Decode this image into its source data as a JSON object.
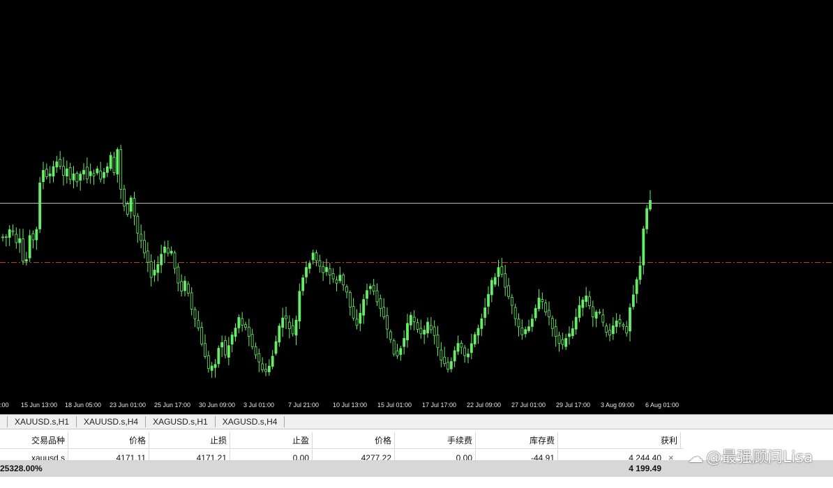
{
  "time_axis": {
    "labels": [
      ":00",
      "15 Jun 13:00",
      "18 Jun 05:00",
      "23 Jun 01:00",
      "25 Jun 17:00",
      "30 Jun 09:00",
      "3 Jul 01:00",
      "7 Jul 21:00",
      "10 Jul 13:00",
      "15 Jul 01:00",
      "17 Jul 17:00",
      "22 Jul 09:00",
      "27 Jul 01:00",
      "29 Jul 17:00",
      "3 Aug 09:00",
      "6 Aug 01:00"
    ]
  },
  "tabs": [
    "XAUUSD.s,H1",
    "XAUUSD.s,H4",
    "XAGUSD.s,H1",
    "XAGUSD.s,H4"
  ],
  "terminal": {
    "headers": [
      "交易品种",
      "价格",
      "止损",
      "止盈",
      "价格",
      "手续费",
      "库存费",
      "获利"
    ],
    "row": [
      "xauusd.s",
      "4171.11",
      "4171.21",
      "0.00",
      "4277.22",
      "0.00",
      "-44.91",
      "4 244.40"
    ],
    "close_symbol": "×",
    "summary_left": "25328.00%",
    "summary_profit": "4 199.49"
  },
  "watermark": {
    "logo": "☁",
    "text": "@最强顾问Lisa"
  },
  "colors": {
    "background": "#000000",
    "candle": "#66ee66",
    "hline": "#b8b8b8",
    "dashline": "#c83a1e"
  },
  "chart_data": {
    "type": "candlestick",
    "x_labels": [
      ":00",
      "15 Jun 13:00",
      "18 Jun 05:00",
      "23 Jun 01:00",
      "25 Jun 17:00",
      "30 Jun 09:00",
      "3 Jul 01:00",
      "7 Jul 21:00",
      "10 Jul 13:00",
      "15 Jul 01:00",
      "17 Jul 17:00",
      "22 Jul 09:00",
      "27 Jul 01:00",
      "29 Jul 17:00",
      "3 Aug 09:00",
      "6 Aug 01:00"
    ],
    "close_path": [
      340,
      340,
      330,
      335,
      350,
      345,
      375,
      372,
      335,
      345,
      330,
      260,
      245,
      255,
      250,
      240,
      230,
      240,
      250,
      240,
      260,
      250,
      258,
      250,
      242,
      255,
      248,
      250,
      245,
      255,
      250,
      240,
      225,
      250,
      215,
      270,
      295,
      305,
      285,
      310,
      335,
      345,
      360,
      375,
      395,
      390,
      380,
      365,
      355,
      365,
      360,
      385,
      405,
      415,
      405,
      420,
      445,
      460,
      470,
      495,
      510,
      530,
      525,
      520,
      500,
      490,
      510,
      495,
      480,
      470,
      455,
      465,
      470,
      480,
      495,
      510,
      520,
      530,
      535,
      525,
      510,
      490,
      470,
      455,
      460,
      470,
      480,
      460,
      420,
      400,
      385,
      375,
      365,
      375,
      380,
      390,
      385,
      395,
      400,
      405,
      395,
      410,
      420,
      440,
      455,
      465,
      450,
      430,
      415,
      410,
      420,
      430,
      440,
      455,
      475,
      490,
      505,
      510,
      500,
      485,
      465,
      455,
      460,
      470,
      480,
      475,
      465,
      470,
      480,
      500,
      515,
      520,
      530,
      520,
      505,
      495,
      500,
      510,
      505,
      495,
      480,
      470,
      455,
      440,
      420,
      405,
      395,
      385,
      395,
      410,
      425,
      440,
      460,
      470,
      480,
      475,
      470,
      455,
      440,
      430,
      435,
      445,
      455,
      470,
      480,
      490,
      495,
      485,
      480,
      470,
      455,
      440,
      430,
      425,
      440,
      455,
      445,
      450,
      465,
      475,
      480,
      470,
      460,
      465,
      470,
      475,
      440,
      420,
      400,
      380,
      330,
      300,
      285
    ],
    "reference_lines": [
      {
        "kind": "solid",
        "y_value": "high"
      },
      {
        "kind": "dash-dot",
        "y_value": "mid"
      }
    ]
  }
}
